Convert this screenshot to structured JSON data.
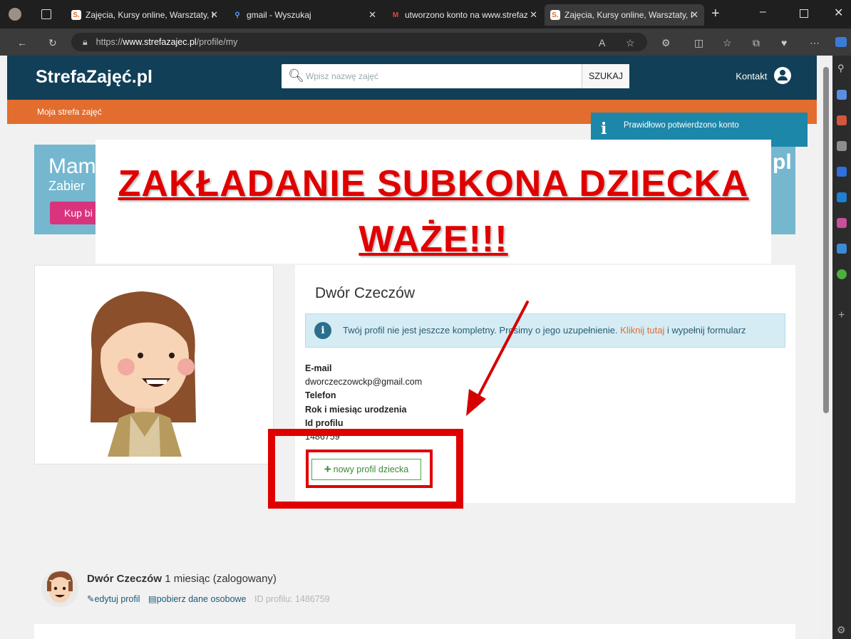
{
  "browser": {
    "tabs": [
      {
        "title": "Zajęcia, Kursy online, Warsztaty, I",
        "favicon": "S.",
        "active": false
      },
      {
        "title": "gmail - Wyszukaj",
        "favicon": "search",
        "active": false
      },
      {
        "title": "utworzono konto na www.strefaz",
        "favicon": "M",
        "active": false
      },
      {
        "title": "Zajęcia, Kursy online, Warsztaty, I",
        "favicon": "S.",
        "active": true
      }
    ],
    "url_prefix": "https://",
    "url_domain": "www.strefazajec.pl",
    "url_path": "/profile/my"
  },
  "site": {
    "logo": "StrefaZajęć.pl",
    "search_placeholder": "Wpisz nazwę zajęć",
    "search_button": "SZUKAJ",
    "contact": "Kontakt",
    "nav_item": "Moja strefa zajęć"
  },
  "toast": "Prawidłowo potwierdzono konto",
  "banner": {
    "line1": "Mam",
    "line2": "Zabier",
    "button": "Kup bi",
    "right_fragment": "pl"
  },
  "overlay": {
    "headline1": "ZAKŁADANIE SUBKONA DZIECKA",
    "headline2": "WAŻE!!!"
  },
  "profile": {
    "name": "Dwór Czeczów",
    "alert_text": "Twój profil nie jest jeszcze kompletny. Prosimy o jego uzupełnienie.",
    "alert_link": "Kliknij tutaj",
    "alert_suffix": "i wypełnij formularz",
    "email_label": "E-mail",
    "email_value": "dworczeczowckp@gmail.com",
    "phone_label": "Telefon",
    "birth_label": "Rok i miesiąc urodzenia",
    "id_label": "Id profilu",
    "id_value": "1486759",
    "child_button": "nowy profil dziecka"
  },
  "user_summary": {
    "name": "Dwór Czeczów",
    "status": "1 miesiąc (zalogowany)",
    "edit_link": "edytuj profil",
    "download_link": "pobierz dane osobowe",
    "profile_id": "ID profilu: 1486759"
  },
  "colors": {
    "header": "#103f57",
    "accent": "#e26d2e",
    "toast": "#1d87a9",
    "annotation": "#e00000",
    "success": "#3a8a3a"
  }
}
